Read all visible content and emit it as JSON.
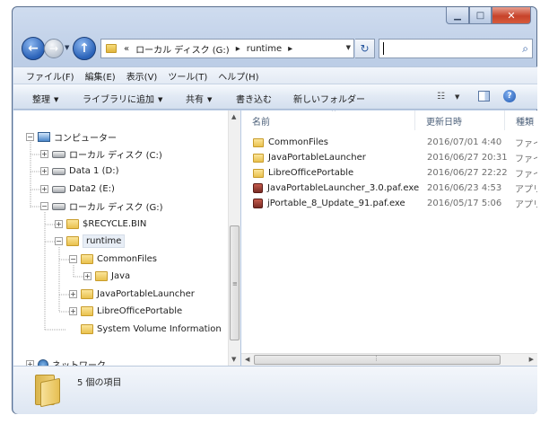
{
  "titlebar": {
    "controls": [
      "minimize-icon",
      "maximize-icon",
      "close-icon"
    ]
  },
  "navbar": {
    "back_icon": "back-arrow-icon",
    "forward_icon": "forward-arrow-icon",
    "up_icon": "up-arrow-icon",
    "address": {
      "overflow": "«",
      "segments": [
        "ローカル ディスク (G:)",
        "runtime"
      ]
    },
    "search": {
      "placeholder": ""
    }
  },
  "menubar": {
    "items": [
      "ファイル(F)",
      "編集(E)",
      "表示(V)",
      "ツール(T)",
      "ヘルプ(H)"
    ]
  },
  "commandbar": {
    "organize": "整理",
    "library": "ライブラリに追加",
    "share": "共有",
    "burn": "書き込む",
    "new_folder": "新しいフォルダー"
  },
  "tree": {
    "computer": "コンピューター",
    "c_drive": "ローカル ディスク (C:)",
    "d_drive": "Data 1 (D:)",
    "e_drive": "Data2 (E:)",
    "g_drive": "ローカル ディスク (G:)",
    "recycle": "$RECYCLE.BIN",
    "runtime": "runtime",
    "commonfiles": "CommonFiles",
    "java": "Java",
    "javalauncher": "JavaPortableLauncher",
    "libreoffice": "LibreOfficePortable",
    "sysvol": "System Volume Information",
    "network": "ネットワーク"
  },
  "filelist": {
    "columns": {
      "name": "名前",
      "date": "更新日時",
      "type": "種類"
    },
    "rows": [
      {
        "name": "CommonFiles",
        "date": "2016/07/01 4:40",
        "type": "ファイ"
      },
      {
        "name": "JavaPortableLauncher",
        "date": "2016/06/27 20:31",
        "type": "ファイ"
      },
      {
        "name": "LibreOfficePortable",
        "date": "2016/06/27 22:22",
        "type": "ファイ"
      },
      {
        "name": "JavaPortableLauncher_3.0.paf.exe",
        "date": "2016/06/23 4:53",
        "type": "アプリ"
      },
      {
        "name": "jPortable_8_Update_91.paf.exe",
        "date": "2016/05/17 5:06",
        "type": "アプリ"
      }
    ]
  },
  "details": {
    "item_count": "5 個の項目"
  }
}
